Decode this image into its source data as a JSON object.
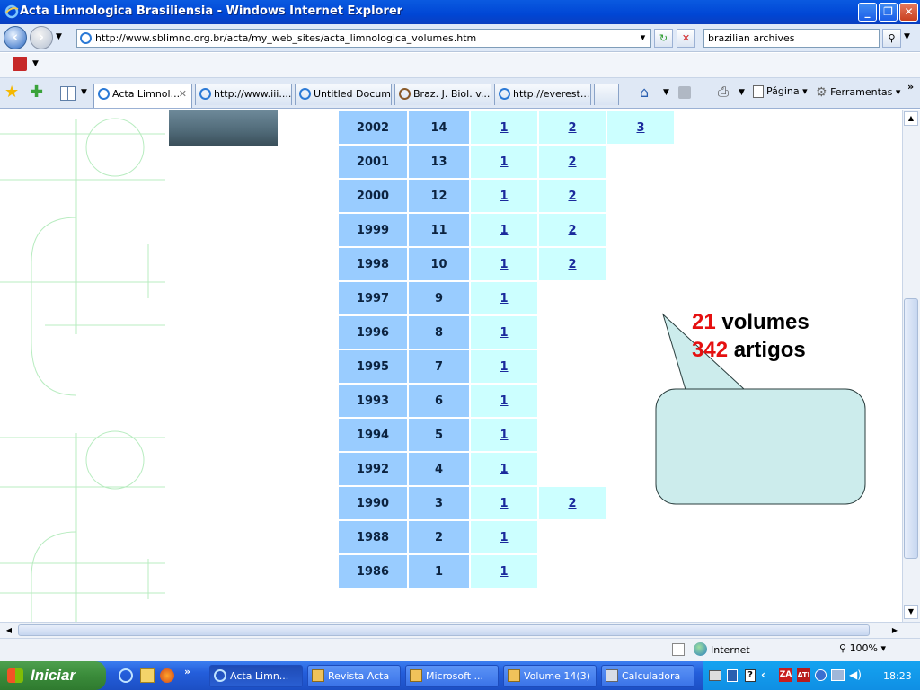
{
  "window": {
    "title": "Acta Limnologica Brasiliensia - Windows Internet Explorer"
  },
  "address": {
    "url": "http://www.sblimno.org.br/acta/my_web_sites/acta_limnologica_volumes.htm",
    "search_value": "brazilian archives"
  },
  "tabs": [
    {
      "label": "Acta Limnol...",
      "active": true
    },
    {
      "label": "http://www.iii...."
    },
    {
      "label": "Untitled Docum..."
    },
    {
      "label": "Braz. J. Biol.  v..."
    },
    {
      "label": "http://everest..."
    }
  ],
  "commandbar": {
    "page_label": "Página",
    "tools_label": "Ferramentas"
  },
  "volumes": [
    {
      "year": "2002",
      "volume": "14",
      "numbers": [
        "1",
        "2",
        "3"
      ]
    },
    {
      "year": "2001",
      "volume": "13",
      "numbers": [
        "1",
        "2"
      ]
    },
    {
      "year": "2000",
      "volume": "12",
      "numbers": [
        "1",
        "2"
      ]
    },
    {
      "year": "1999",
      "volume": "11",
      "numbers": [
        "1",
        "2"
      ]
    },
    {
      "year": "1998",
      "volume": "10",
      "numbers": [
        "1",
        "2"
      ]
    },
    {
      "year": "1997",
      "volume": "9",
      "numbers": [
        "1"
      ]
    },
    {
      "year": "1996",
      "volume": "8",
      "numbers": [
        "1"
      ]
    },
    {
      "year": "1995",
      "volume": "7",
      "numbers": [
        "1"
      ]
    },
    {
      "year": "1993",
      "volume": "6",
      "numbers": [
        "1"
      ]
    },
    {
      "year": "1994",
      "volume": "5",
      "numbers": [
        "1"
      ]
    },
    {
      "year": "1992",
      "volume": "4",
      "numbers": [
        "1"
      ]
    },
    {
      "year": "1990",
      "volume": "3",
      "numbers": [
        "1",
        "2"
      ]
    },
    {
      "year": "1988",
      "volume": "2",
      "numbers": [
        "1"
      ]
    },
    {
      "year": "1986",
      "volume": "1",
      "numbers": [
        "1"
      ]
    }
  ],
  "callout": {
    "volumes_count": "21",
    "volumes_word": "volumes",
    "articles_count": "342",
    "articles_word": "artigos"
  },
  "statusbar": {
    "zone": "Internet",
    "zoom": "100%"
  },
  "taskbar": {
    "start_label": "Iniciar",
    "tasks": [
      {
        "label": "Acta Limn...",
        "active": true
      },
      {
        "label": "Revista Acta"
      },
      {
        "label": "Microsoft ..."
      },
      {
        "label": "Volume 14(3)"
      },
      {
        "label": "Calculadora"
      }
    ],
    "clock": "18:23"
  }
}
